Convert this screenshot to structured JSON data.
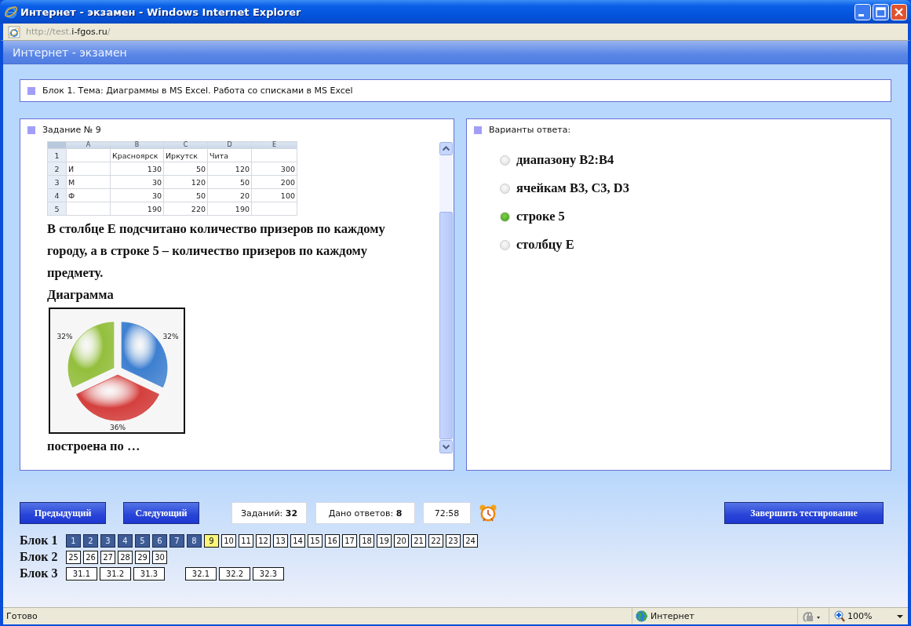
{
  "window": {
    "title": "Интернет - экзамен - Windows Internet Explorer",
    "url": [
      {
        "text": "http://test.",
        "dim": true
      },
      {
        "text": "i-fgos.ru",
        "dim": false
      },
      {
        "text": "/",
        "dim": true
      }
    ]
  },
  "page_header": "Интернет - экзамен",
  "topic": "Блок 1. Тема: Диаграммы в MS Excel. Работа со списками в MS Excel",
  "task": {
    "title": "Задание № 9",
    "sheet": {
      "columns": [
        "",
        "A",
        "B",
        "C",
        "D",
        "E"
      ],
      "rows": [
        {
          "kind": "labels",
          "cells": [
            "1",
            "",
            "Красноярск",
            "Иркутск",
            "Чита",
            ""
          ]
        },
        {
          "kind": "numbers",
          "cells": [
            "2",
            "И",
            "130",
            "50",
            "120",
            "300"
          ]
        },
        {
          "kind": "numbers",
          "cells": [
            "3",
            "М",
            "30",
            "120",
            "50",
            "200"
          ]
        },
        {
          "kind": "numbers",
          "cells": [
            "4",
            "Ф",
            "30",
            "50",
            "20",
            "100"
          ]
        },
        {
          "kind": "numbers",
          "cells": [
            "5",
            "",
            "190",
            "220",
            "190",
            ""
          ]
        }
      ]
    },
    "paragraphs": [
      "В столбце Е подсчитано количество призеров по каждому городу, а в строке 5 – количество призеров по каждому предмету.",
      "Диаграмма"
    ],
    "chart_data": {
      "type": "pie",
      "values": [
        32,
        36,
        32
      ],
      "colors": [
        "#3d7fd0",
        "#d4403e",
        "#93bf3c"
      ],
      "value_labels": [
        "32%",
        "36%",
        "32%"
      ]
    },
    "closing": "построена по …"
  },
  "answers": {
    "title": "Варианты ответа:",
    "options": [
      {
        "text": "диапазону B2:B4",
        "selected": false
      },
      {
        "text": "ячейкам B3, C3, D3",
        "selected": false
      },
      {
        "text": "строке 5",
        "selected": true
      },
      {
        "text": "столбцу E",
        "selected": false
      }
    ]
  },
  "footer": {
    "prev": "Предыдущий",
    "next": "Следующий",
    "stats": [
      "Заданий: **32**",
      "Дано ответов: **8**"
    ],
    "timer": "72:58",
    "finish": "Завершить тестирование"
  },
  "blocks": [
    {
      "label": "Блок 1",
      "kind": "narrow",
      "groups": [
        [
          {
            "n": "1",
            "answered": true,
            "selected": false
          },
          {
            "n": "2",
            "answered": true,
            "selected": false
          },
          {
            "n": "3",
            "answered": true,
            "selected": false
          },
          {
            "n": "4",
            "answered": true,
            "selected": false
          },
          {
            "n": "5",
            "answered": true,
            "selected": false
          },
          {
            "n": "6",
            "answered": true,
            "selected": false
          },
          {
            "n": "7",
            "answered": true,
            "selected": false
          },
          {
            "n": "8",
            "answered": true,
            "selected": false
          },
          {
            "n": "9",
            "answered": false,
            "selected": true
          },
          {
            "n": "10",
            "answered": false,
            "selected": false
          },
          {
            "n": "11",
            "answered": false,
            "selected": false
          },
          {
            "n": "12",
            "answered": false,
            "selected": false
          },
          {
            "n": "13",
            "answered": false,
            "selected": false
          },
          {
            "n": "14",
            "answered": false,
            "selected": false
          },
          {
            "n": "15",
            "answered": false,
            "selected": false
          },
          {
            "n": "16",
            "answered": false,
            "selected": false
          },
          {
            "n": "17",
            "answered": false,
            "selected": false
          },
          {
            "n": "18",
            "answered": false,
            "selected": false
          },
          {
            "n": "19",
            "answered": false,
            "selected": false
          },
          {
            "n": "20",
            "answered": false,
            "selected": false
          },
          {
            "n": "21",
            "answered": false,
            "selected": false
          },
          {
            "n": "22",
            "answered": false,
            "selected": false
          },
          {
            "n": "23",
            "answered": false,
            "selected": false
          },
          {
            "n": "24",
            "answered": false,
            "selected": false
          }
        ]
      ]
    },
    {
      "label": "Блок 2",
      "kind": "narrow",
      "groups": [
        [
          {
            "n": "25",
            "answered": false,
            "selected": false
          },
          {
            "n": "26",
            "answered": false,
            "selected": false
          },
          {
            "n": "27",
            "answered": false,
            "selected": false
          },
          {
            "n": "28",
            "answered": false,
            "selected": false
          },
          {
            "n": "29",
            "answered": false,
            "selected": false
          },
          {
            "n": "30",
            "answered": false,
            "selected": false
          }
        ]
      ]
    },
    {
      "label": "Блок 3",
      "kind": "wide",
      "groups": [
        [
          {
            "n": "31.1",
            "answered": false,
            "selected": false
          },
          {
            "n": "31.2",
            "answered": false,
            "selected": false
          },
          {
            "n": "31.3",
            "answered": false,
            "selected": false
          }
        ],
        [
          {
            "n": "32.1",
            "answered": false,
            "selected": false
          },
          {
            "n": "32.2",
            "answered": false,
            "selected": false
          },
          {
            "n": "32.3",
            "answered": false,
            "selected": false
          }
        ]
      ]
    }
  ],
  "status_bar": {
    "text": "Готово",
    "zone": "Интернет",
    "zoom": "100%"
  }
}
